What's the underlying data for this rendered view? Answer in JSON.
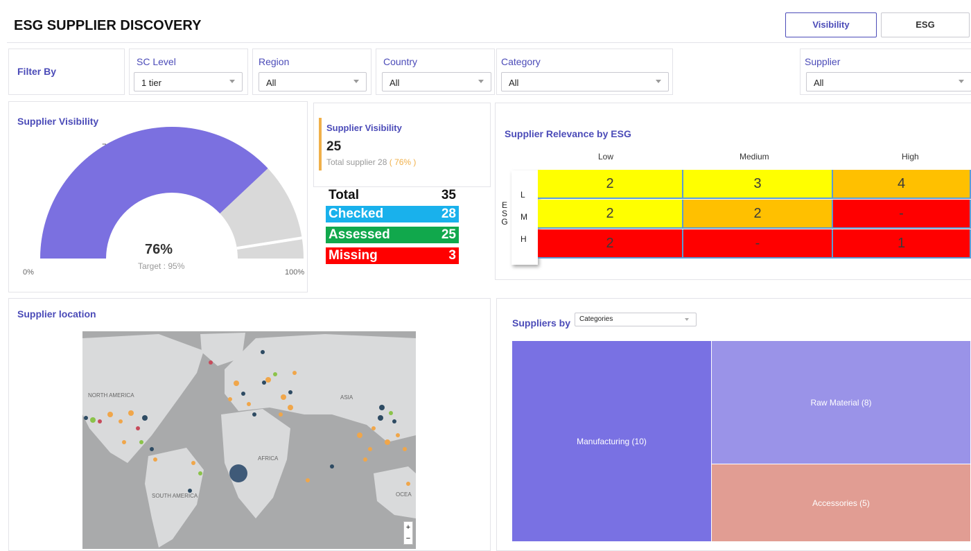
{
  "header": {
    "title": "ESG SUPPLIER DISCOVERY",
    "tabs": [
      "Visibility",
      "ESG"
    ]
  },
  "filters": {
    "label": "Filter By",
    "sc_level": {
      "label": "SC Level",
      "value": "1 tier"
    },
    "region": {
      "label": "Region",
      "value": "All"
    },
    "country": {
      "label": "Country",
      "value": "All"
    },
    "category": {
      "label": "Category",
      "value": "All"
    },
    "supplier": {
      "label": "Supplier",
      "value": "All"
    }
  },
  "gauge": {
    "title": "Supplier Visibility",
    "value_label": "76%",
    "top_label": "76%",
    "target_label": "Target : 95%",
    "min_label": "0%",
    "max_label": "100%",
    "value": 76,
    "target": 95,
    "fill_color": "#7b70e0",
    "rest_color": "#d9d9d9"
  },
  "kpi": {
    "title": "Supplier Visibility",
    "value": "25",
    "total_text": "Total supplier 28",
    "pct_text": "( 76% )",
    "accent": "#f0b04a"
  },
  "summary": {
    "rows": [
      {
        "label": "Total",
        "value": "35",
        "color": "#ffffff"
      },
      {
        "label": "Checked",
        "value": "28",
        "color": "#19b1ec"
      },
      {
        "label": "Assessed",
        "value": "25",
        "color": "#11a84c"
      },
      {
        "label": "Missing",
        "value": "3",
        "color": "#ff0000"
      }
    ]
  },
  "relevance": {
    "title": "Supplier Relevance by ESG",
    "columns": [
      "Low",
      "Medium",
      "High"
    ],
    "axis_letters": [
      "E",
      "S",
      "G"
    ],
    "rows": [
      "L",
      "M",
      "H"
    ],
    "cells": [
      [
        "2",
        "3",
        "4"
      ],
      [
        "2",
        "2",
        "-"
      ],
      [
        "2",
        "-",
        "1"
      ]
    ],
    "colors": [
      [
        "#ffff00",
        "#ffff00",
        "#ffc000"
      ],
      [
        "#ffff00",
        "#ffc000",
        "#ff0000"
      ],
      [
        "#ff0000",
        "#ff0000",
        "#ff0000"
      ]
    ]
  },
  "location": {
    "title": "Supplier location",
    "labels": [
      "NORTH AMERICA",
      "ASIA",
      "AFRICA",
      "SOUTH AMERICA",
      "OCEA"
    ],
    "zoom_in": "+",
    "zoom_out": "−"
  },
  "treemap": {
    "title": "Suppliers by",
    "select_value": "Categories",
    "items": [
      {
        "label": "Manufacturing (10)",
        "value": 10,
        "color": "#7971e3"
      },
      {
        "label": "Raw Material (8)",
        "value": 8,
        "color": "#9a93e8"
      },
      {
        "label": "Accessories (5)",
        "value": 5,
        "color": "#e19d93"
      }
    ]
  }
}
